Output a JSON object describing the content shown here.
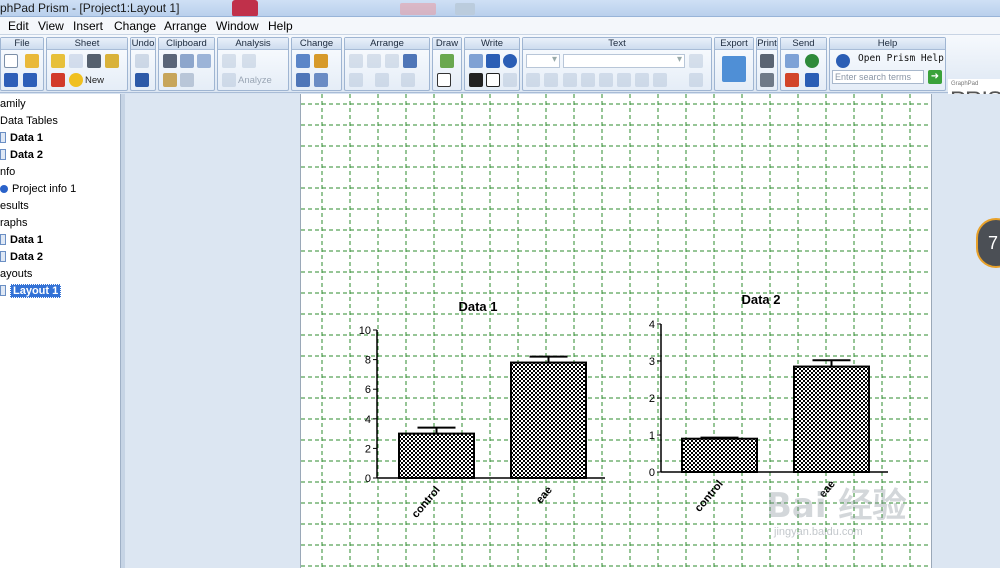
{
  "window": {
    "title": "phPad Prism - [Project1:Layout 1]"
  },
  "menu": [
    "Edit",
    "View",
    "Insert",
    "Change",
    "Arrange",
    "Window",
    "Help"
  ],
  "toolbar": {
    "groups": [
      "File",
      "Sheet",
      "Undo",
      "Clipboard",
      "Analysis",
      "Change",
      "Arrange",
      "Draw",
      "Write",
      "Text",
      "Export",
      "Print",
      "Send",
      "Help"
    ],
    "sheet_new_label": "New",
    "analyze_label": "Analyze",
    "help_link": "Open Prism Help",
    "search_placeholder": "Enter search terms",
    "brand_top": "GraphPad",
    "brand_main": "PRISM"
  },
  "navigator": {
    "rows": [
      {
        "label": "amily",
        "kind": "section"
      },
      {
        "label": "Data Tables",
        "kind": "section"
      },
      {
        "label": "Data 1",
        "kind": "item"
      },
      {
        "label": "Data 2",
        "kind": "item"
      },
      {
        "label": "nfo",
        "kind": "section"
      },
      {
        "label": "Project info 1",
        "kind": "info"
      },
      {
        "label": "esults",
        "kind": "section"
      },
      {
        "label": "raphs",
        "kind": "section"
      },
      {
        "label": "Data 1",
        "kind": "item"
      },
      {
        "label": "Data 2",
        "kind": "item"
      },
      {
        "label": "ayouts",
        "kind": "section"
      },
      {
        "label": "Layout 1",
        "kind": "selected"
      }
    ]
  },
  "scroll_badge": "7",
  "watermark": {
    "main": "Bai 经验",
    "sub": "jingyan.baidu.com"
  },
  "colors": {
    "grid": "#2e8b2e",
    "bar_fill_dark": "#000000",
    "bar_fill_light": "#ffffff",
    "selection": "#3372d6"
  },
  "chart_data": [
    {
      "type": "bar",
      "title": "Data 1",
      "categories": [
        "control",
        "eae"
      ],
      "values": [
        3.0,
        7.8
      ],
      "error_plus": [
        0.4,
        0.4
      ],
      "ylim": [
        0,
        10
      ],
      "yticks": [
        0,
        2,
        4,
        6,
        8,
        10
      ],
      "xlabel": "",
      "ylabel": ""
    },
    {
      "type": "bar",
      "title": "Data 2",
      "categories": [
        "control",
        "eae"
      ],
      "values": [
        0.9,
        2.85
      ],
      "error_plus": [
        0.03,
        0.17
      ],
      "ylim": [
        0,
        4
      ],
      "yticks": [
        0,
        1,
        2,
        3,
        4
      ],
      "xlabel": "",
      "ylabel": ""
    }
  ]
}
